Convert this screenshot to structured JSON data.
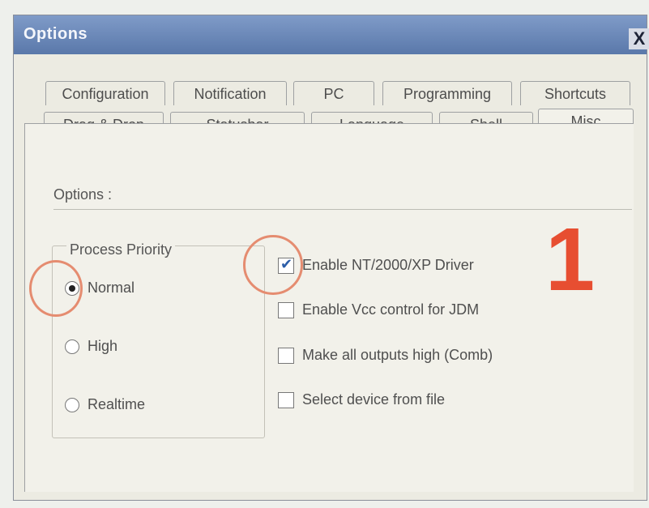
{
  "window": {
    "title": "Options",
    "close_glyph": "X"
  },
  "tabs_row1": [
    "Configuration",
    "Notification",
    "PC",
    "Programming",
    "Shortcuts"
  ],
  "tabs_row2": [
    "Drag & Drop",
    "Statusbar",
    "Language",
    "Shell",
    "Misc"
  ],
  "active_tab": "Misc",
  "section": {
    "label": "Options :"
  },
  "process_priority": {
    "label": "Process Priority",
    "options": [
      "Normal",
      "High",
      "Realtime"
    ],
    "selected": "Normal"
  },
  "checkboxes": [
    {
      "label": "Enable NT/2000/XP Driver",
      "checked": true
    },
    {
      "label": "Enable Vcc control for JDM",
      "checked": false
    },
    {
      "label": "Make all outputs high (Comb)",
      "checked": false
    },
    {
      "label": "Select device from file",
      "checked": false
    }
  ],
  "annotation": {
    "number": "1",
    "color": "#e74e31"
  }
}
